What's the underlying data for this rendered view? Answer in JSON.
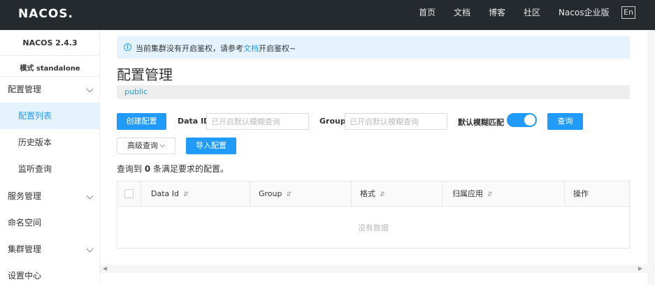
{
  "topbar": {
    "logo": "NACOS.",
    "nav": [
      "首页",
      "文档",
      "博客",
      "社区",
      "Nacos企业版"
    ],
    "lang": "En"
  },
  "sidebar": {
    "version": "NACOS 2.4.3",
    "mode": "模式 standalone",
    "items": [
      {
        "label": "配置管理",
        "expandable": true
      },
      {
        "label": "配置列表",
        "active": true
      },
      {
        "label": "历史版本"
      },
      {
        "label": "监听查询"
      },
      {
        "label": "服务管理",
        "expandable": true
      },
      {
        "label": "命名空间"
      },
      {
        "label": "集群管理",
        "expandable": true
      },
      {
        "label": "设置中心"
      }
    ]
  },
  "notice": {
    "prefix": "当前集群没有开启鉴权，请参考",
    "link": "文档",
    "suffix": "开启鉴权~",
    "icon": "info-icon"
  },
  "page": {
    "title": "配置管理",
    "namespace": "public"
  },
  "filters": {
    "create_button": "创建配置",
    "data_id_label": "Data ID",
    "data_id_placeholder": "已开启默认模糊查询",
    "group_label": "Group",
    "group_placeholder": "已开启默认模糊查询",
    "fuzzy_label": "默认模糊匹配",
    "fuzzy_enabled": true,
    "query_button": "查询",
    "advanced_button": "高级查询",
    "import_button": "导入配置"
  },
  "result": {
    "prefix": "查询到",
    "count": "0",
    "suffix": "条满足要求的配置。"
  },
  "table": {
    "columns": [
      "Data Id",
      "Group",
      "格式",
      "归属应用",
      "操作"
    ],
    "empty_text": "没有数据"
  },
  "colors": {
    "primary": "#209bfa",
    "topbar": "#252a2f",
    "active_bg": "#e4f3fe"
  }
}
